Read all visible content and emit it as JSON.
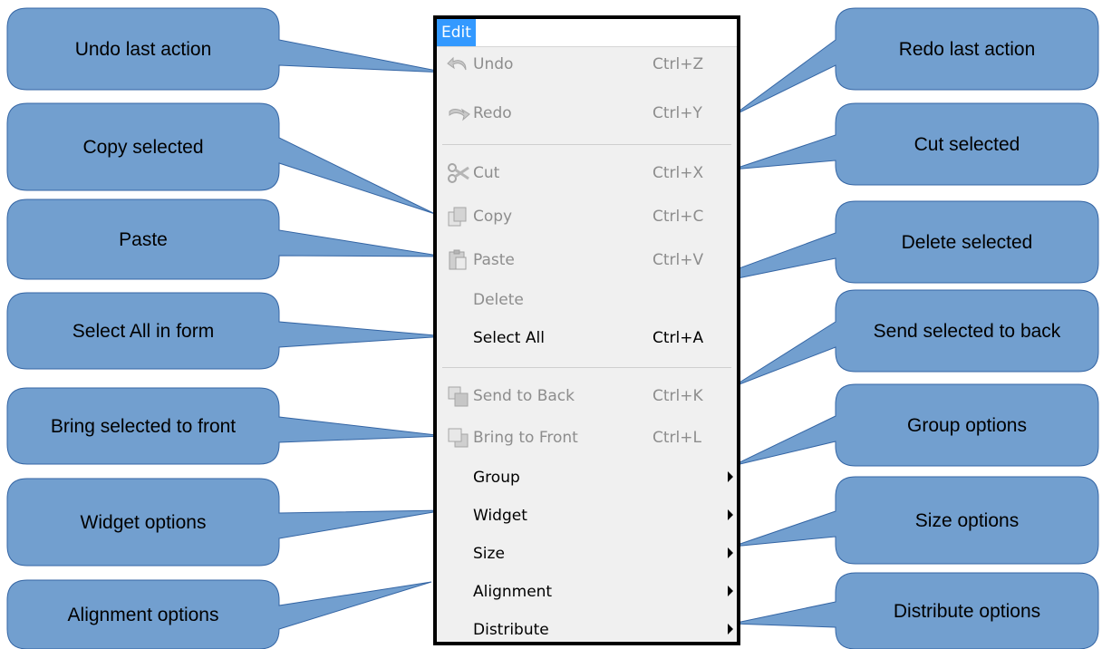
{
  "menu": {
    "title": "Edit",
    "items": [
      {
        "label": "Undo",
        "shortcut": "Ctrl+Z",
        "icon": "undo-icon",
        "enabled": false
      },
      {
        "label": "Redo",
        "shortcut": "Ctrl+Y",
        "icon": "redo-icon",
        "enabled": false
      },
      {
        "label": "Cut",
        "shortcut": "Ctrl+X",
        "icon": "scissors-icon",
        "enabled": false
      },
      {
        "label": "Copy",
        "shortcut": "Ctrl+C",
        "icon": "copy-icon",
        "enabled": false
      },
      {
        "label": "Paste",
        "shortcut": "Ctrl+V",
        "icon": "paste-icon",
        "enabled": false
      },
      {
        "label": "Delete",
        "shortcut": "",
        "icon": "",
        "enabled": false
      },
      {
        "label": "Select All",
        "shortcut": "Ctrl+A",
        "icon": "",
        "enabled": true
      },
      {
        "label": "Send to Back",
        "shortcut": "Ctrl+K",
        "icon": "send-to-back-icon",
        "enabled": false
      },
      {
        "label": "Bring to Front",
        "shortcut": "Ctrl+L",
        "icon": "bring-to-front-icon",
        "enabled": false
      },
      {
        "label": "Group",
        "shortcut": "",
        "icon": "",
        "enabled": true,
        "submenu": true
      },
      {
        "label": "Widget",
        "shortcut": "",
        "icon": "",
        "enabled": true,
        "submenu": true
      },
      {
        "label": "Size",
        "shortcut": "",
        "icon": "",
        "enabled": true,
        "submenu": true
      },
      {
        "label": "Alignment",
        "shortcut": "",
        "icon": "",
        "enabled": true,
        "submenu": true
      },
      {
        "label": "Distribute",
        "shortcut": "",
        "icon": "",
        "enabled": true,
        "submenu": true
      }
    ]
  },
  "callouts": {
    "left": [
      "Undo last action",
      "Copy selected",
      "Paste",
      "Select All in form",
      "Bring selected to front",
      "Widget options",
      "Alignment options"
    ],
    "right": [
      "Redo last action",
      "Cut selected",
      "Delete selected",
      "Send selected to back",
      "Group options",
      "Size options",
      "Distribute options"
    ]
  },
  "colors": {
    "callout_fill": "#729fcf",
    "callout_stroke": "#3465a4",
    "highlight": "#3399ff",
    "disabled_text": "#8d8d8d"
  }
}
